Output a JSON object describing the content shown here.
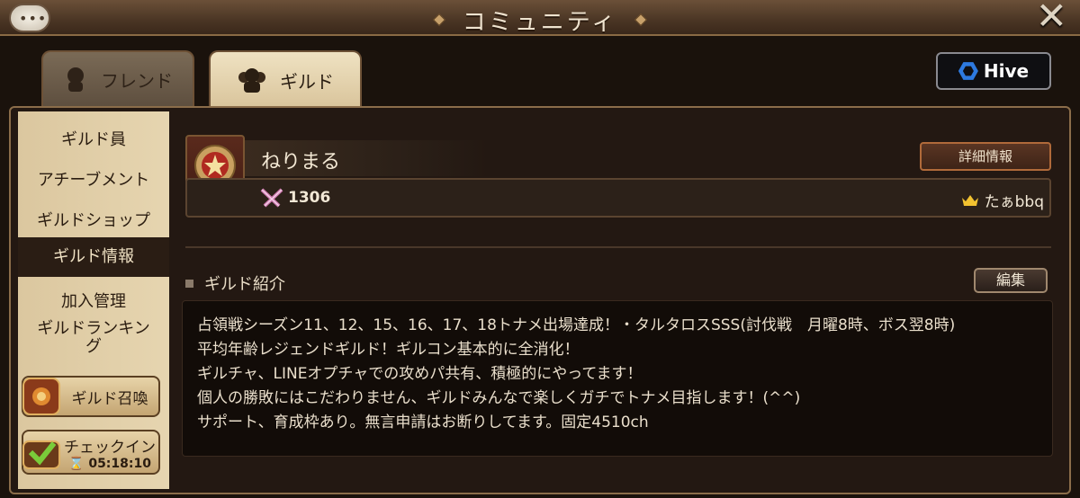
{
  "title": "コミュニティ",
  "tabs": [
    {
      "label": "フレンド",
      "icon": "friend-icon"
    },
    {
      "label": "ギルド",
      "icon": "guild-icon"
    }
  ],
  "hive_label": "Hive",
  "sidebar": {
    "items": [
      {
        "label": "ギルド員"
      },
      {
        "label": "アチーブメント"
      },
      {
        "label": "ギルドショップ"
      },
      {
        "label": "ギルド情報"
      },
      {
        "label": "加入管理"
      },
      {
        "label": "ギルドランキン",
        "label2": "グ"
      }
    ],
    "summon_label": "ギルド召喚",
    "checkin_label": "チェックイン",
    "checkin_timer": "05:18:10"
  },
  "guild": {
    "name": "ねりまる",
    "detail_label": "詳細情報",
    "power": "1306",
    "leader": "たぁbbq"
  },
  "intro": {
    "label": "ギルド紹介",
    "edit_label": "編集",
    "lines": [
      "占領戦シーズン11、12、15、16、17、18トナメ出場達成！・タルタロスSSS(討伐戦　月曜8時、ボス翌8時)",
      "平均年齢レジェンドギルド！ギルコン基本的に全消化！",
      "ギルチャ、LINEオプチャでの攻めパ共有、積極的にやってます！",
      "個人の勝敗にはこだわりません、ギルドみんなで楽しくガチでトナメ目指します！(^^)",
      "サポート、育成枠あり。無言申請はお断りしてます。固定4510ch"
    ]
  }
}
